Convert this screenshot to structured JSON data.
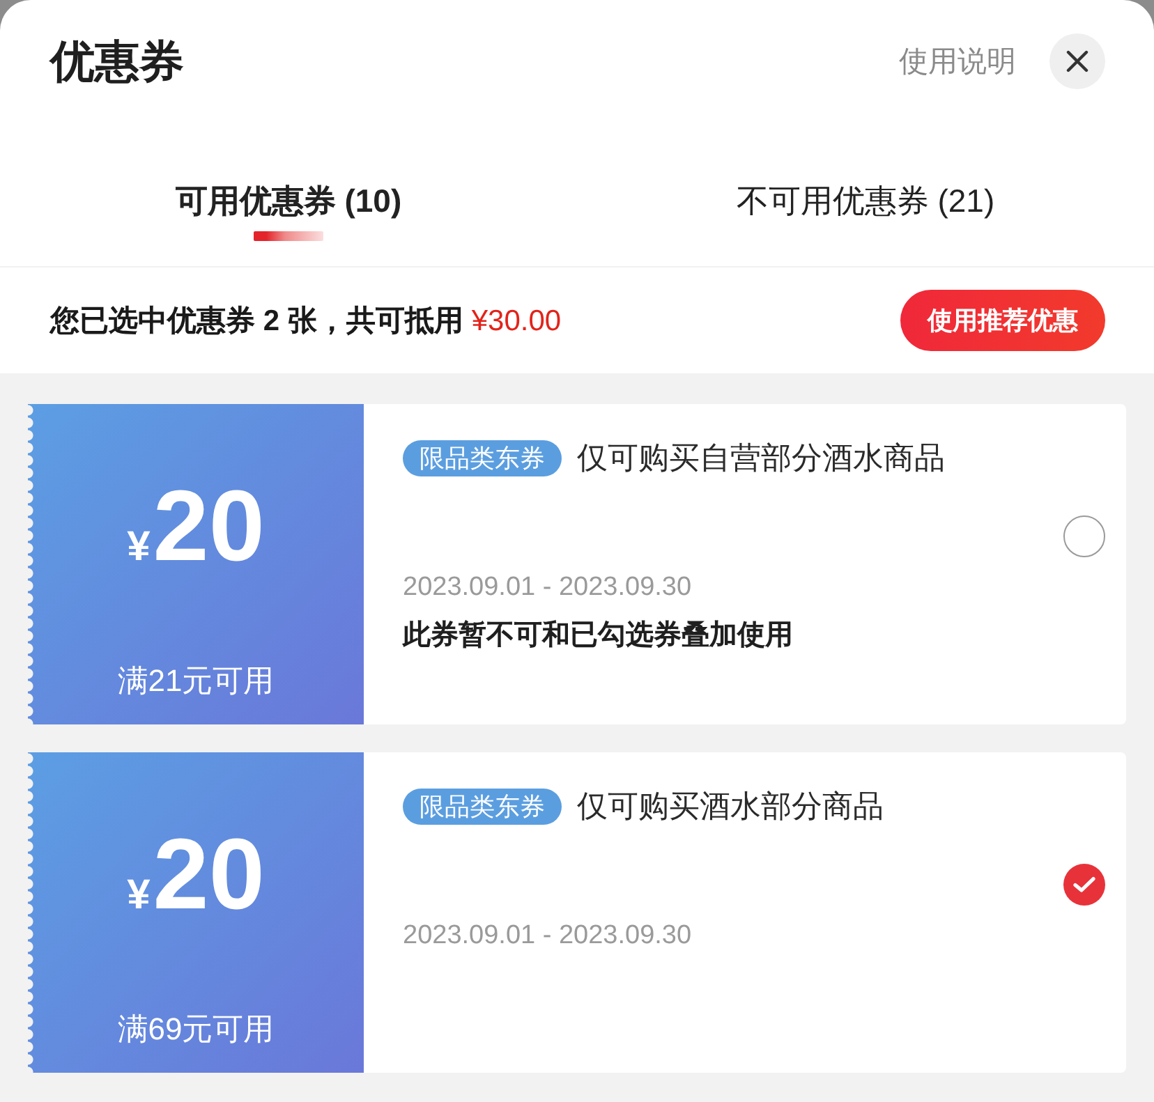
{
  "header": {
    "title": "优惠券",
    "help_link": "使用说明"
  },
  "tabs": [
    {
      "label": "可用优惠券 (10)",
      "selected": true
    },
    {
      "label": "不可用优惠券 (21)",
      "selected": false
    }
  ],
  "summary": {
    "text": "您已选中优惠券 2 张，共可抵用",
    "amount": "¥30.00",
    "button": "使用推荐优惠"
  },
  "coupons": [
    {
      "currency": "¥",
      "amount": "20",
      "condition": "满21元可用",
      "tag": "限品类东券",
      "description": "仅可购买自营部分酒水商品",
      "date_range": "2023.09.01 - 2023.09.30",
      "note": "此券暂不可和已勾选券叠加使用",
      "selected": false
    },
    {
      "currency": "¥",
      "amount": "20",
      "condition": "满69元可用",
      "tag": "限品类东券",
      "description": "仅可购买酒水部分商品",
      "date_range": "2023.09.01 - 2023.09.30",
      "selected": true
    }
  ]
}
